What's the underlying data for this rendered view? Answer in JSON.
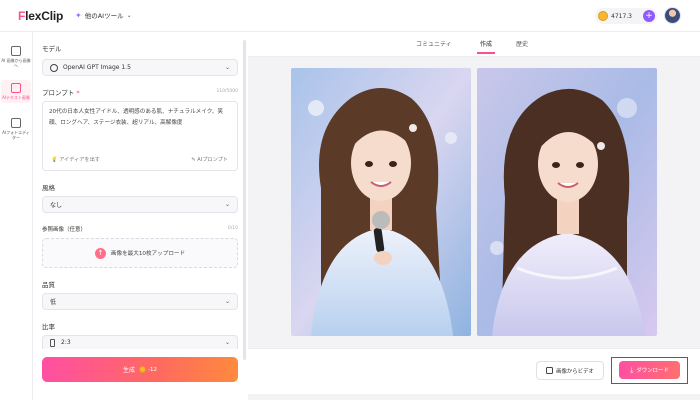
{
  "header": {
    "logo": "FlexClip",
    "ai_tools": "他のAIツール",
    "credits": "4717.3"
  },
  "leftnav": {
    "items": [
      {
        "label": "AI 画像から画像へ",
        "icon": "image-to-image-icon"
      },
      {
        "label": "AIテキスト画像",
        "icon": "text-to-image-icon"
      },
      {
        "label": "AIフォトエディター",
        "icon": "photo-editor-icon"
      }
    ]
  },
  "panel": {
    "model_label": "モデル",
    "model_value": "OpenAI GPT Image 1.5",
    "prompt_label": "プロンプト",
    "prompt_counter": "110/5000",
    "prompt_text": "20代の日本人女性アイドル、透明感のある肌、ナチュラルメイク、笑顔、ロングヘア、ステージ衣装、超リアル、高解像度",
    "idea_label": "アイディアを出す",
    "ai_prompt_label": "AIプロンプト",
    "style_label": "風格",
    "style_value": "なし",
    "ref_label": "参照画像（任意）",
    "ref_counter": "0/10",
    "upload_label": "画像を最大10枚アップロード",
    "quality_label": "品質",
    "quality_value": "低",
    "ratio_label": "比率",
    "ratio_value": "2:3",
    "generate_label": "生成",
    "generate_cost": "-12"
  },
  "main": {
    "tabs": [
      "コミュニティ",
      "作成",
      "歴史"
    ],
    "active_tab": "作成",
    "image_to_video_label": "画像からビデオ",
    "download_label": "ダウンロード"
  },
  "colors": {
    "accent": "#ff4f8b",
    "highlight_border": "#e0242b"
  }
}
